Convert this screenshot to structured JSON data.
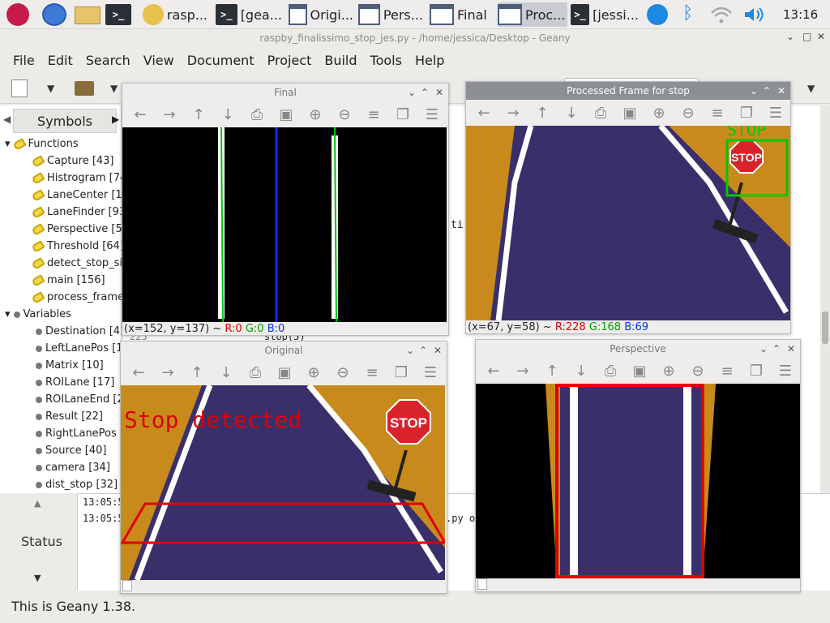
{
  "taskbar": {
    "items": [
      {
        "label": "rasp...",
        "icon": "genie-icon"
      },
      {
        "label": "[gea...",
        "icon": "terminal-icon"
      },
      {
        "label": "Origi...",
        "icon": "window-icon"
      },
      {
        "label": "Pers...",
        "icon": "window-icon"
      },
      {
        "label": "Final",
        "icon": "window-icon"
      },
      {
        "label": "Proc...",
        "icon": "window-icon"
      },
      {
        "label": "[jessi...",
        "icon": "terminal-icon"
      }
    ],
    "terminal_glyph": ">_",
    "clock": "13:16"
  },
  "geany": {
    "title": "raspby_finalissimo_stop_jes.py - /home/jessica/Desktop - Geany",
    "menus": [
      "File",
      "Edit",
      "Search",
      "View",
      "Document",
      "Project",
      "Build",
      "Tools",
      "Help"
    ],
    "sidebar_tab": "Symbols",
    "functions_label": "Functions",
    "functions": [
      "Capture [43]",
      "Histrogram [74",
      "LaneCenter [10",
      "LaneFinder [93",
      "Perspective [50",
      "Threshold [64]",
      "detect_stop_sig",
      "main [156]",
      "process_frame_"
    ],
    "variables_label": "Variables",
    "variables": [
      "Destination [41",
      "LeftLanePos [1",
      "Matrix [10]",
      "ROILane [17]",
      "ROILaneEnd [2",
      "Result [22]",
      "RightLanePos [",
      "Source [40]",
      "camera [34]",
      "dist_stop [32]"
    ],
    "editor_fragments": {
      "frag1": "ti",
      "frag2": "225",
      "frag3": "stop(5)"
    },
    "status_tab": "Status",
    "log_lines": [
      "13:05:5",
      "13:05:5"
    ],
    "log_suffix": ".py o",
    "statusbar": "This is Geany 1.38."
  },
  "windows": {
    "final": {
      "title": "Final",
      "status": {
        "coords": "(x=152, y=137) ~ ",
        "r": "R:0",
        "g": "G:0",
        "b": "B:0"
      }
    },
    "processed": {
      "title": "Processed Frame for stop",
      "overlay_text": "STOP",
      "sign_text": "STOP",
      "status": {
        "coords": "(x=67, y=58) ~ ",
        "r": "R:228",
        "g": "G:168",
        "b": "B:69"
      }
    },
    "original": {
      "title": "Original",
      "overlay_text": "Stop detected",
      "sign_text": "STOP"
    },
    "perspective": {
      "title": "Perspective"
    }
  },
  "toolbar_glyphs": {
    "left": "←",
    "right": "→",
    "up": "↑",
    "down": "↓",
    "save": "⎙",
    "fit": "▣",
    "zoom_in": "⊕",
    "zoom_out": "⊖",
    "props": "≡",
    "copy": "❐",
    "expand": "☰"
  },
  "window_controls": {
    "minimize": "⌄",
    "maximize": "⌃",
    "close": "✕"
  },
  "colors": {
    "red": "#e00000",
    "green": "#00c800",
    "blue": "#0033ff",
    "carpet": "#3a2f6b",
    "floor": "#c98a1c"
  }
}
